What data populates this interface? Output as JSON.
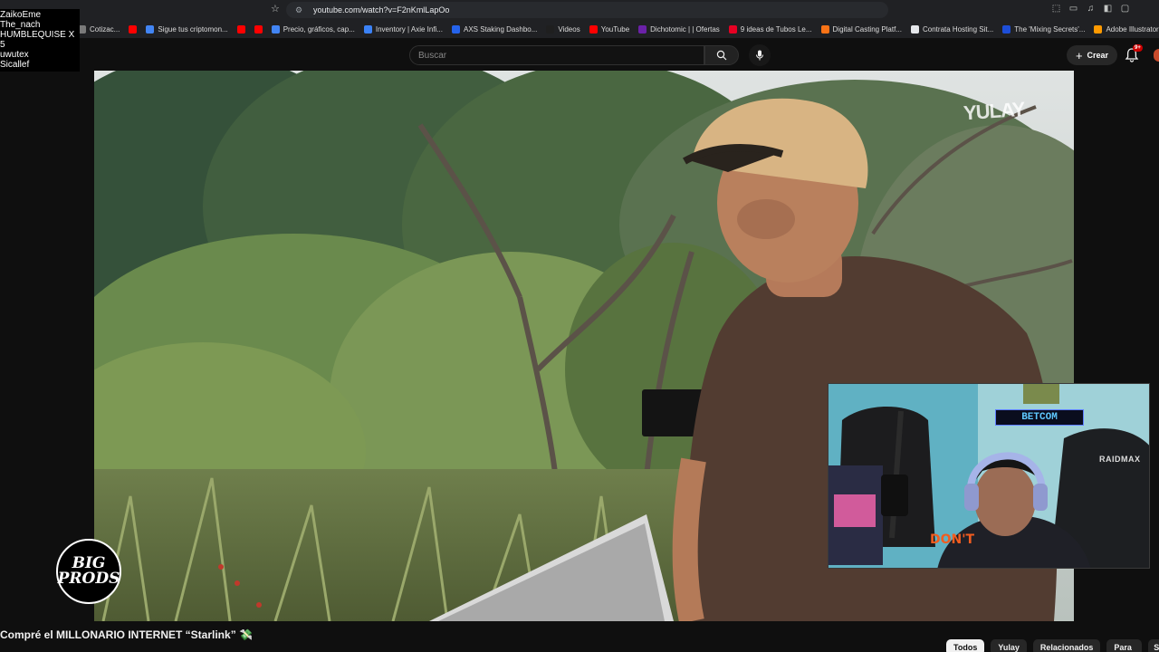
{
  "browser": {
    "url": "youtube.com/watch?v=F2nKmlLapOo",
    "bookmarks": [
      {
        "label": "Cotizac...",
        "color": "#7a7a7a"
      },
      {
        "label": "",
        "color": "#ff0000"
      },
      {
        "label": "Sigue tus criptomon...",
        "color": "#4285f4"
      },
      {
        "label": "",
        "color": "#ff0000"
      },
      {
        "label": "",
        "color": "#ff0000"
      },
      {
        "label": "Precio, gráficos, cap...",
        "color": "#4285f4"
      },
      {
        "label": "Inventory | Axie Infi...",
        "color": "#3b82f6"
      },
      {
        "label": "AXS Staking Dashbo...",
        "color": "#2563eb"
      },
      {
        "label": "Videos",
        "color": "#1f1f1f"
      },
      {
        "label": "YouTube",
        "color": "#ff0000"
      },
      {
        "label": "Dichotomic | | Ofertas",
        "color": "#6b21a8"
      },
      {
        "label": "9 ideas de Tubos Le...",
        "color": "#e60023"
      },
      {
        "label": "Digital Casting Platf...",
        "color": "#f97316"
      },
      {
        "label": "Contrata Hosting Sit...",
        "color": "#e5e7eb"
      },
      {
        "label": "The 'Mixing Secrets'...",
        "color": "#1d4ed8"
      },
      {
        "label": "Adobe Illustrator CC...",
        "color": "#ff9a00"
      }
    ]
  },
  "overlay_names": [
    "ZaikoEme",
    "The_nach",
    "HUMBLEQUISE X 5",
    "uwutex",
    "Sicallef"
  ],
  "header": {
    "search_placeholder": "Buscar",
    "create_label": "Crear",
    "notification_count": "9+"
  },
  "video": {
    "watermark": "YULAY",
    "title": "Compré el MILLONARIO INTERNET “Starlink” 💸"
  },
  "webcam": {
    "neon_sign": "BETCOM",
    "chair_brand": "RAIDMAX"
  },
  "logo": {
    "line1": "BIG",
    "line2": "PRODS"
  },
  "chips": [
    "Todos",
    "Yulay",
    "Relacionados",
    "Para ti",
    "S"
  ],
  "colors": {
    "background": "#0f0f0f",
    "chip_active": "#f1f1f1",
    "chip": "#272727",
    "badge": "#cc0000"
  }
}
